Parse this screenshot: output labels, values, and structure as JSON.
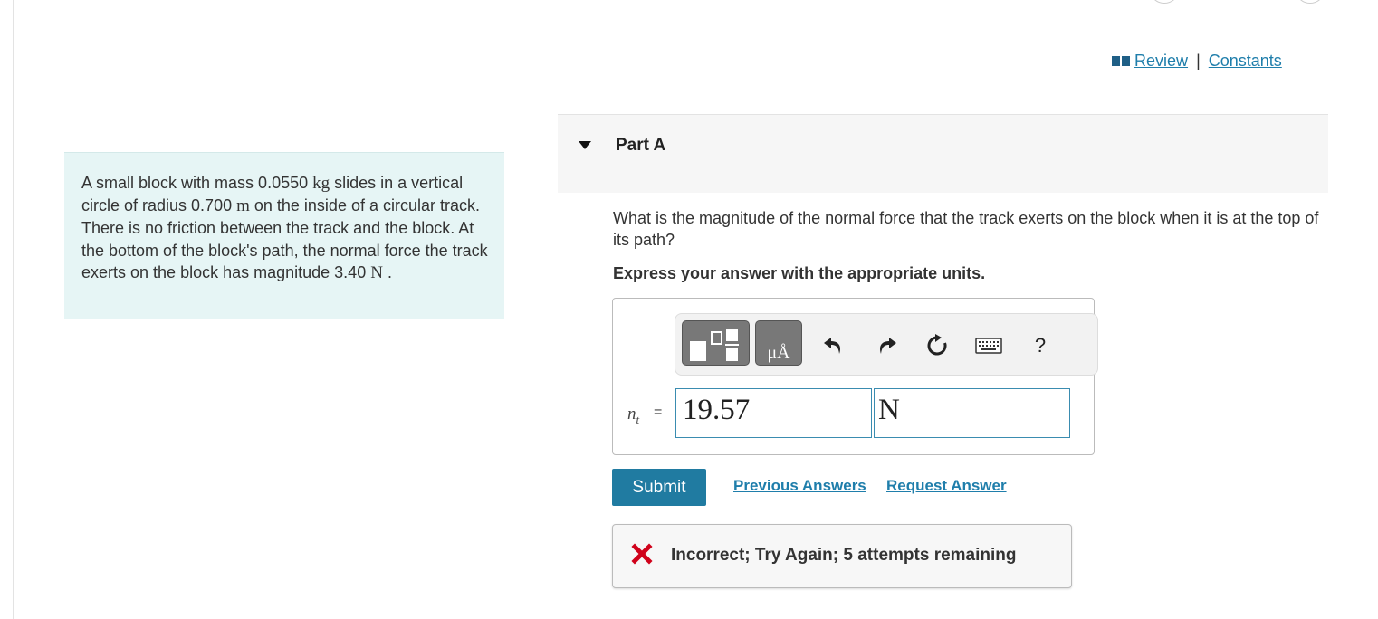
{
  "problem": {
    "text_1": "A small block with mass 0.0550 ",
    "unit_kg": "kg",
    "text_2": " slides in a vertical circle of radius 0.700 ",
    "unit_m": "m",
    "text_3": " on the inside of a circular track. There is no friction between the track and the block. At the bottom of the block's path, the normal force the track exerts on the block has magnitude 3.40 ",
    "unit_N": "N",
    "text_4": " ."
  },
  "links": {
    "review": "Review",
    "separator": "|",
    "constants": "Constants",
    "review_icon": "book-icon"
  },
  "part": {
    "title": "Part A",
    "toggle_icon": "collapse-triangle-icon"
  },
  "question": {
    "text": "What is the magnitude of the normal force that the track exerts on the block when it is at the top of its path?",
    "instruction": "Express your answer with the appropriate units."
  },
  "toolbar": {
    "template_icon": "templates-icon",
    "units_label": "μÅ",
    "undo_icon": "undo-icon",
    "redo_icon": "redo-icon",
    "reset_icon": "reset-icon",
    "keyboard_icon": "keyboard-icon",
    "help_label": "?"
  },
  "answer": {
    "variable": "n",
    "variable_sub": "t",
    "equals": "=",
    "value": "19.57",
    "unit": "N"
  },
  "actions": {
    "submit": "Submit",
    "previous_answers": "Previous Answers",
    "request_answer": "Request Answer"
  },
  "feedback": {
    "text": "Incorrect; Try Again; 5 attempts remaining",
    "icon": "x-icon"
  },
  "colors": {
    "accent": "#207ba1",
    "link": "#1f7eab",
    "problem_bg": "#e6f5f5",
    "error": "#d0021b"
  }
}
